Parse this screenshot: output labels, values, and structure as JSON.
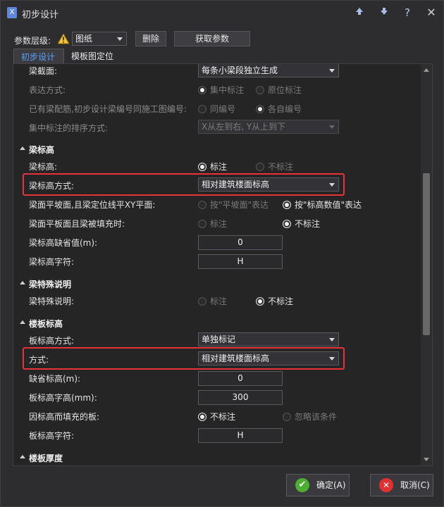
{
  "window": {
    "title": "初步设计",
    "icon": "app-logo-icon",
    "controls": [
      "arrow-up-icon",
      "arrow-down-icon",
      "help-icon",
      "close-icon"
    ],
    "help_glyph": "?",
    "close_glyph": "✕"
  },
  "toolbar": {
    "level_label": "参数层级:",
    "level_value": "图纸",
    "delete_label": "删除",
    "fetch_label": "获取参数"
  },
  "tabs": [
    {
      "label": "初步设计",
      "active": true
    },
    {
      "label": "模板图定位",
      "active": false
    }
  ],
  "rows": {
    "beam_section": {
      "name": "梁截面:",
      "value": "每条小梁段独立生成"
    },
    "expression": {
      "name": "表达方式:",
      "opt1": "集中标注",
      "opt2": "原位标注"
    },
    "numbering": {
      "name": "已有梁配筋,初步设计梁编号同施工图编号:",
      "opt1": "同编号",
      "opt2": "各自编号"
    },
    "sort": {
      "name": "集中标注的排序方式:",
      "value": "X从左到右, Y从上到下"
    },
    "beam_elev_section": {
      "name": "梁标高"
    },
    "beam_elev": {
      "name": "梁标高:",
      "opt1": "标注",
      "opt2": "不标注"
    },
    "beam_elev_mode": {
      "name": "梁标高方式:",
      "value": "相对建筑楼面标高"
    },
    "beam_slope": {
      "name": "梁面平坡面,且梁定位线平XY平面:",
      "opt1": "按\"平坡面\"表达",
      "opt2": "按\"标高数值\"表达"
    },
    "beam_fill": {
      "name": "梁面平板面且梁被填充时:",
      "opt1": "标注",
      "opt2": "不标注"
    },
    "beam_default": {
      "name": "梁标高缺省值(m):",
      "value": "0"
    },
    "beam_char": {
      "name": "梁标高字符:",
      "value": "H"
    },
    "beam_special_section": {
      "name": "梁特殊说明"
    },
    "beam_special": {
      "name": "梁特殊说明:",
      "opt1": "标注",
      "opt2": "不标注"
    },
    "slab_elev_section": {
      "name": "楼板标高"
    },
    "slab_elev_mode": {
      "name": "板标高方式:",
      "value": "单独标记"
    },
    "mode": {
      "name": "方式:",
      "value": "相对建筑楼面标高"
    },
    "default_elev": {
      "name": "缺省标高(m):",
      "value": "0"
    },
    "slab_char_height": {
      "name": "板标高字高(mm):",
      "value": "300"
    },
    "fill_slab": {
      "name": "因标高而填充的板:",
      "opt1": "不标注",
      "opt2": "忽略该条件"
    },
    "slab_char": {
      "name": "板标高字符:",
      "value": "H"
    },
    "slab_thickness_section": {
      "name": "楼板厚度"
    }
  },
  "footer": {
    "ok_label": "确定(A)",
    "cancel_label": "取消(C)"
  },
  "colors": {
    "highlight": "#e8323a",
    "active_tab": "#5aa0ff",
    "ok": "#4caf32",
    "cancel": "#e03030"
  }
}
